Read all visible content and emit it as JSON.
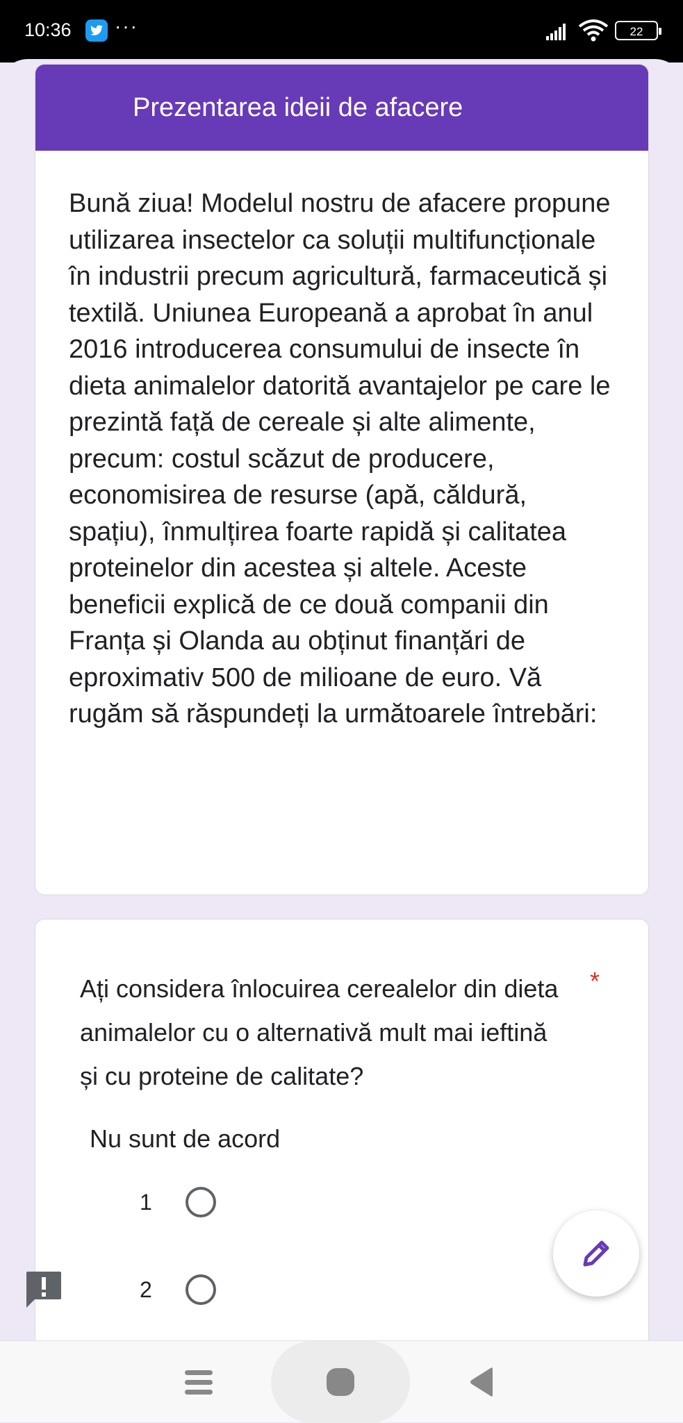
{
  "status": {
    "time": "10:36",
    "more": "···",
    "battery": "22"
  },
  "form": {
    "title": "Prezentarea ideii de afacere",
    "description": "Bună ziua! Modelul nostru de afacere propune utilizarea insectelor ca soluții multifuncționale în industrii precum agricultură, farmaceutică și textilă. Uniunea Europeană a aprobat în anul 2016 introducerea consumului de insecte în dieta animalelor datorită avantajelor pe care le prezintă față de cereale și alte alimente, precum: costul scăzut de producere, economisirea de resurse (apă, căldură, spațiu), înmulțirea foarte rapidă și calitatea proteinelor din acestea și altele. Aceste beneficii explică de ce două companii din Franța și Olanda au obținut finanțări de eproximativ 500 de milioane de euro. Vă rugăm să răspundeți la următoarele întrebări:"
  },
  "question": {
    "text": "Ați considera înlocuirea cerealelor din dieta animalelor cu o alternativă mult mai ieftină și cu proteine de calitate?",
    "required_mark": "*",
    "scale_low_label": "Nu sunt de acord",
    "options": [
      "1",
      "2"
    ]
  },
  "colors": {
    "accent": "#673ab7",
    "background": "#ede7f6",
    "required": "#d93025"
  },
  "icons": {
    "fab": "pencil-icon",
    "feedback": "feedback-icon",
    "nav": [
      "menu-icon",
      "home-icon",
      "back-icon"
    ]
  }
}
